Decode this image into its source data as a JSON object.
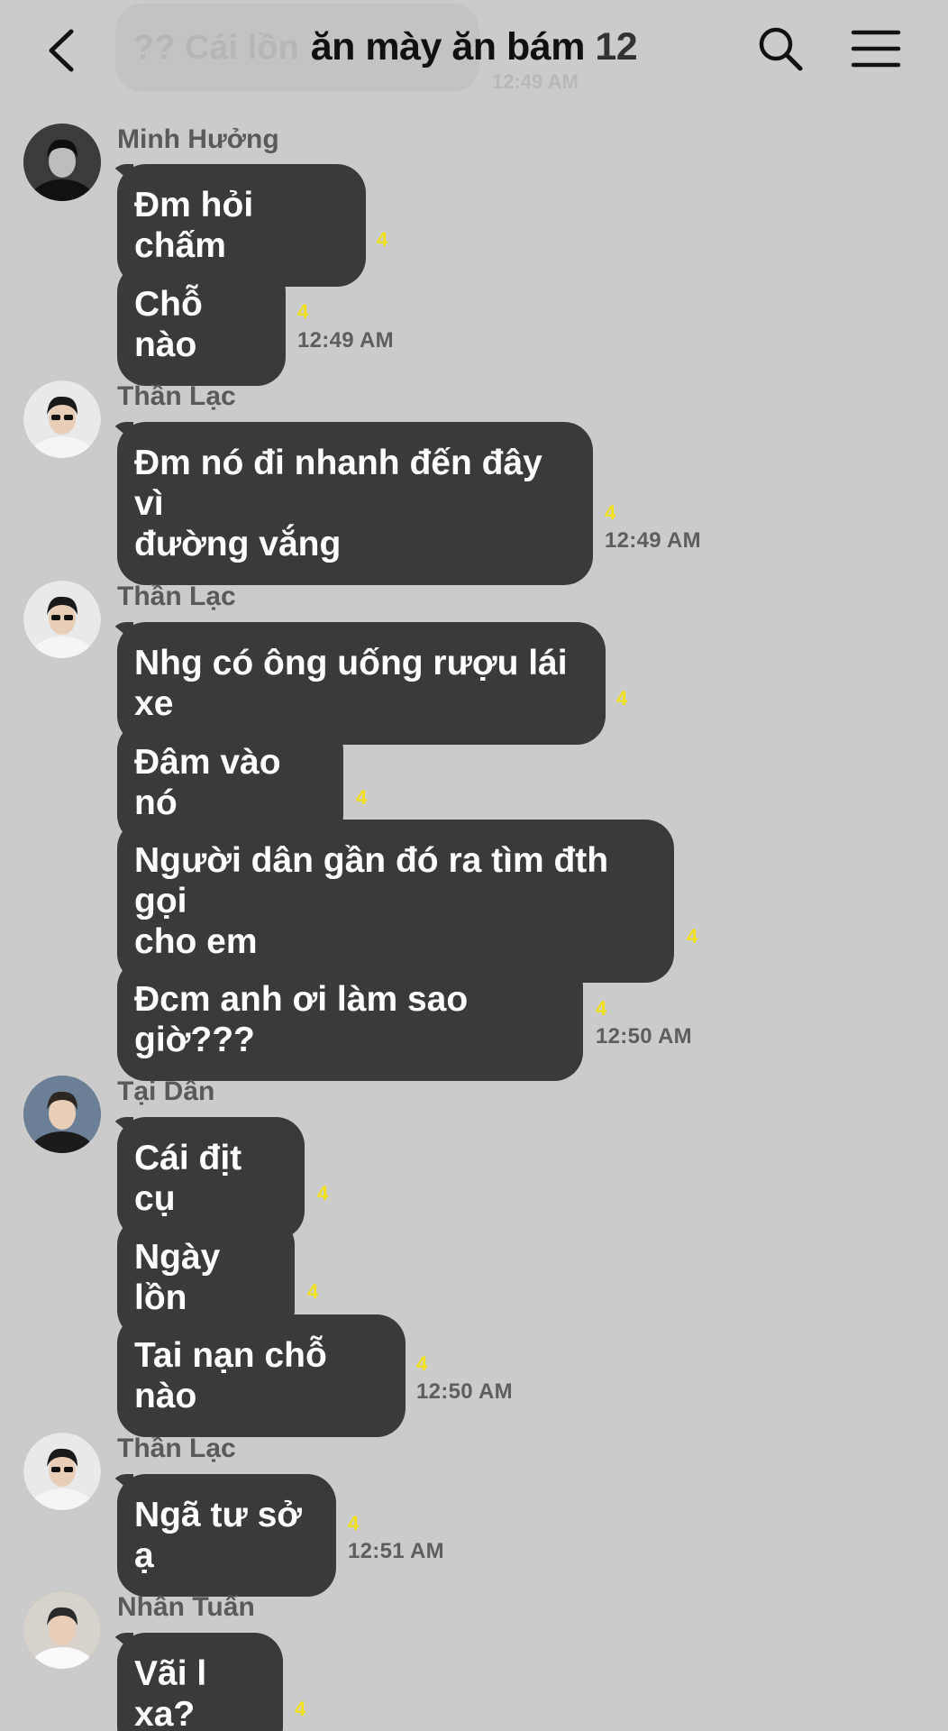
{
  "header": {
    "title": "ăn mày ăn bám",
    "member_count": "12",
    "back_icon": "chevron-left-icon",
    "search_icon": "search-icon",
    "menu_icon": "hamburger-menu-icon"
  },
  "previous_message": {
    "text": "?? Cái lồn",
    "time": "12:49 AM"
  },
  "groups": [
    {
      "sender": "Minh Hưởng",
      "messages": [
        {
          "text": "Đm hỏi chấm",
          "unread": "4"
        },
        {
          "text": "Chỗ nào",
          "unread": "4",
          "time": "12:49 AM"
        }
      ]
    },
    {
      "sender": "Thần Lạc",
      "messages": [
        {
          "text": "Đm nó đi nhanh đến đây vì\nđường vắng",
          "unread": "4",
          "time": "12:49 AM"
        }
      ]
    },
    {
      "sender": "Thần Lạc",
      "messages": [
        {
          "text": "Nhg có ông uống rượu lái xe",
          "unread": "4"
        },
        {
          "text": "Đâm vào nó",
          "unread": "4"
        },
        {
          "text": "Người dân gần đó ra tìm đth gọi\ncho em",
          "unread": "4"
        },
        {
          "text": "Đcm anh ơi làm sao giờ???",
          "unread": "4",
          "time": "12:50 AM"
        }
      ]
    },
    {
      "sender": "Tại Dân",
      "messages": [
        {
          "text": "Cái địt cụ",
          "unread": "4"
        },
        {
          "text": "Ngày lồn",
          "unread": "4"
        },
        {
          "text": "Tai nạn chỗ nào",
          "unread": "4",
          "time": "12:50 AM"
        }
      ]
    },
    {
      "sender": "Thần Lạc",
      "messages": [
        {
          "text": "Ngã tư sở ạ",
          "unread": "4",
          "time": "12:51 AM"
        }
      ]
    },
    {
      "sender": "Nhân Tuấn",
      "messages": [
        {
          "text": "Vãi l xa?",
          "unread": "4"
        }
      ]
    }
  ],
  "colors": {
    "background": "#cbcbcb",
    "bubble": "#3a3a3c",
    "bubble_text": "#ffffff",
    "unread_count": "#f3e21a",
    "sender_name": "#5a5a5a",
    "timestamp": "#5e5e5e"
  }
}
